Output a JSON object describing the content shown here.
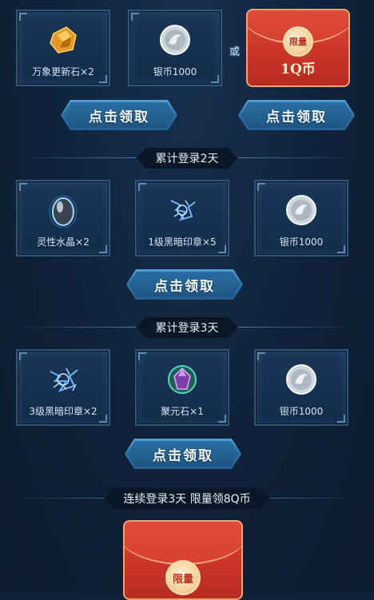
{
  "colors": {
    "background": "#0f2138",
    "card_border": "#2f567a",
    "button": "#2e76ac",
    "red_envelope": "#c93428",
    "seal_gold": "#f6d19a"
  },
  "row1": {
    "items": [
      {
        "label": "万象更新石×2",
        "icon": "amber-stone-icon"
      },
      {
        "label": "银币1000",
        "icon": "silver-coin-icon"
      }
    ],
    "or_text": "或",
    "red_envelope": {
      "seal": "限量",
      "amount": "1Q币"
    },
    "claim_left": "点击领取",
    "claim_right": "点击领取"
  },
  "day2": {
    "title": "累计登录2天",
    "items": [
      {
        "label": "灵性水晶×2",
        "icon": "crystal-egg-icon"
      },
      {
        "label": "1级黑暗印章×5",
        "icon": "dark-seal-icon"
      },
      {
        "label": "银币1000",
        "icon": "silver-coin-icon"
      }
    ],
    "claim": "点击领取"
  },
  "day3": {
    "title": "累计登录3天",
    "items": [
      {
        "label": "3级黑暗印章×2",
        "icon": "dark-seal-icon"
      },
      {
        "label": "聚元石×1",
        "icon": "spirit-stone-icon"
      },
      {
        "label": "银币1000",
        "icon": "silver-coin-icon"
      }
    ],
    "claim": "点击领取"
  },
  "consecutive": {
    "title": "连续登录3天 限量领8Q币",
    "red_envelope": {
      "seal": "限量"
    }
  }
}
